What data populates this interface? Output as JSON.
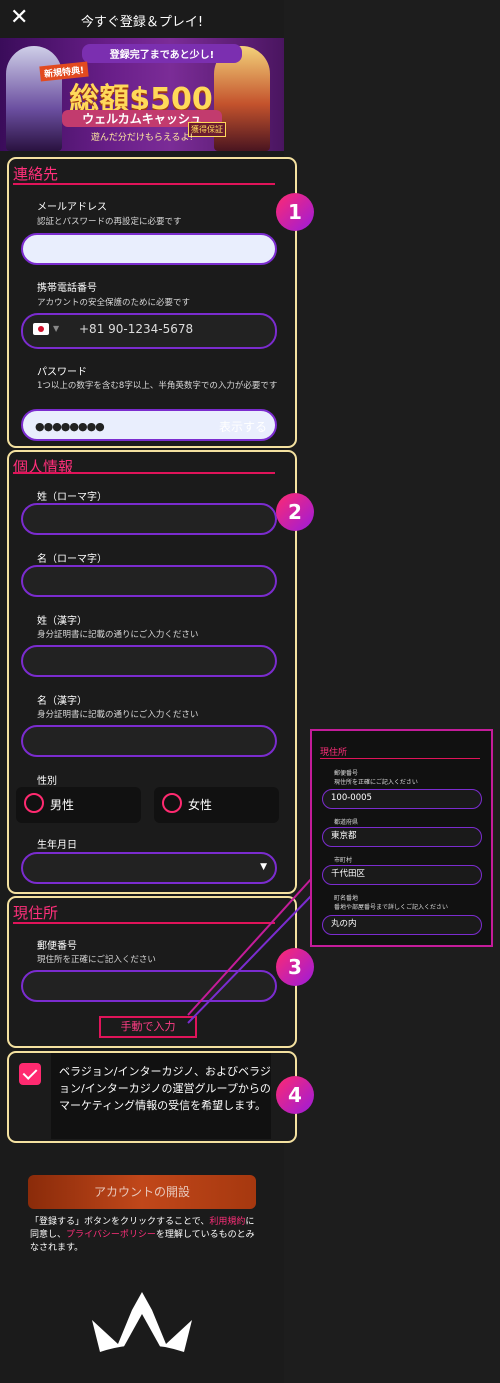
{
  "header": {
    "close_icon": "close-icon",
    "title": "今すぐ登録＆プレイ!"
  },
  "banner": {
    "line1": "登録完了まであと少し!",
    "badge": "新規特典!",
    "amount": "総額$500",
    "welcome": "ウェルカムキャッシュ",
    "seal": "獲得保証",
    "sub": "遊んだ分だけもらえるよ!"
  },
  "sections": {
    "contact": {
      "number": "1",
      "title": "連絡先",
      "email_label": "メールアドレス",
      "email_hint": "認証とパスワードの再設定に必要です",
      "phone_label": "携帯電話番号",
      "phone_hint": "アカウントの安全保護のために必要です",
      "phone_placeholder": "+81 90-1234-5678",
      "password_label": "パスワード",
      "password_hint": "1つ以上の数字を含む8字以上、半角英数字での入力が必要です",
      "password_value": "●●●●●●●●",
      "password_show": "表示する"
    },
    "personal": {
      "number": "2",
      "title": "個人情報",
      "last_roman": "姓（ローマ字）",
      "first_roman": "名（ローマ字）",
      "last_kanji": "姓（漢字）",
      "last_kanji_hint": "身分証明書に記載の通りにご入力ください",
      "first_kanji": "名（漢字）",
      "first_kanji_hint": "身分証明書に記載の通りにご入力ください",
      "gender_label": "性別",
      "male": "男性",
      "female": "女性",
      "dob_label": "生年月日"
    },
    "address": {
      "number": "3",
      "title": "現住所",
      "postal_label": "郵便番号",
      "postal_hint": "現住所を正確にご記入ください",
      "manual": "手動で入力"
    },
    "consent": {
      "number": "4",
      "text": "ベラジョン/インターカジノ、およびベラジョン/インターカジノの運営グループからのマーケティング情報の受信を希望します。"
    }
  },
  "cta": {
    "label": "アカウントの開設"
  },
  "terms": {
    "p1": "「登録する」ボタンをクリックすることで、",
    "link1": "利用規約",
    "p2": "に同意し、",
    "link2": "プライバシーポリシー",
    "p3": "を理解しているものとみなされます。"
  },
  "callout": {
    "title": "現住所",
    "postal_label": "郵便番号",
    "postal_hint": "現住所を正確にご記入ください",
    "postal_value": "100-0005",
    "pref_label": "都道府県",
    "pref_value": "東京都",
    "city_label": "市町村",
    "city_value": "千代田区",
    "street_label": "町名番地",
    "street_hint": "番地や部屋番号まで詳しくご記入ください",
    "street_value": "丸の内"
  },
  "colors": {
    "accent": "#ff2f7a",
    "input_border": "#7b2ccf",
    "section_border": "#f4e1a0"
  }
}
